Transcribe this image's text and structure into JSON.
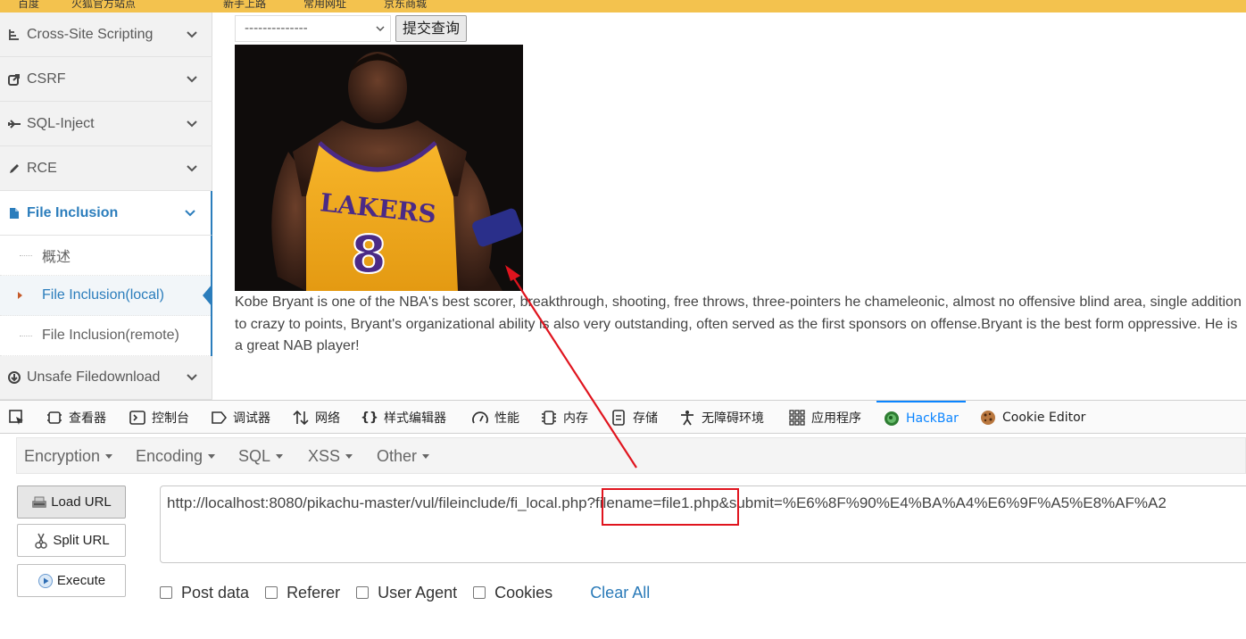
{
  "bookmarks": [
    "百度",
    "火狐官方站点",
    "新手上路",
    "常用网址",
    "京东商城"
  ],
  "sidebar": {
    "items": [
      {
        "label": "Cross-Site Scripting",
        "icon": "sitemap-icon"
      },
      {
        "label": "CSRF",
        "icon": "share-icon"
      },
      {
        "label": "SQL-Inject",
        "icon": "fighter-jet-icon"
      },
      {
        "label": "RCE",
        "icon": "pencil-icon"
      },
      {
        "label": "File Inclusion",
        "icon": "file-icon"
      },
      {
        "label": "Unsafe Filedownload",
        "icon": "download-icon"
      }
    ],
    "submenu": [
      {
        "label": "概述"
      },
      {
        "label": "File Inclusion(local)"
      },
      {
        "label": "File Inclusion(remote)"
      }
    ]
  },
  "content": {
    "select_value": "--------------",
    "submit_label": "提交查询",
    "bio": "Kobe Bryant is one of the NBA's best scorer, breakthrough, shooting, free throws, three-pointers he chameleonic, almost no offensive blind area, single addition to crazy to points, Bryant's organizational ability is also very outstanding, often served as the first sponsors on offense.Bryant is the best form oppressive. He is a great NAB player!",
    "jersey_text": "LAKERS",
    "jersey_number": "8"
  },
  "devtools": {
    "tabs": [
      {
        "label": "",
        "icon": "pick-element-icon"
      },
      {
        "label": "查看器",
        "icon": "inspector-icon"
      },
      {
        "label": "控制台",
        "icon": "console-icon"
      },
      {
        "label": "调试器",
        "icon": "debugger-icon"
      },
      {
        "label": "网络",
        "icon": "network-icon"
      },
      {
        "label": "样式编辑器",
        "icon": "style-editor-icon"
      },
      {
        "label": "性能",
        "icon": "performance-icon"
      },
      {
        "label": "内存",
        "icon": "memory-icon"
      },
      {
        "label": "存储",
        "icon": "storage-icon"
      },
      {
        "label": "无障碍环境",
        "icon": "accessibility-icon"
      },
      {
        "label": "应用程序",
        "icon": "application-icon"
      },
      {
        "label": "HackBar",
        "icon": "hackbar-icon"
      },
      {
        "label": "Cookie Editor",
        "icon": "cookie-icon"
      }
    ]
  },
  "hackbar": {
    "menus": [
      "Encryption",
      "Encoding",
      "SQL",
      "XSS",
      "Other"
    ],
    "buttons": {
      "load": "Load URL",
      "split": "Split URL",
      "execute": "Execute"
    },
    "url": "http://localhost:8080/pikachu-master/vul/fileinclude/fi_local.php?filename=file1.php&submit=%E6%8F%90%E4%BA%A4%E6%9F%A5%E8%AF%A2",
    "checkboxes": [
      "Post data",
      "Referer",
      "User Agent",
      "Cookies"
    ],
    "clear_all": "Clear All"
  },
  "colors": {
    "accent": "#2b7dbc",
    "annotation": "#e0141e",
    "devtools_selected": "#0a84ff"
  }
}
